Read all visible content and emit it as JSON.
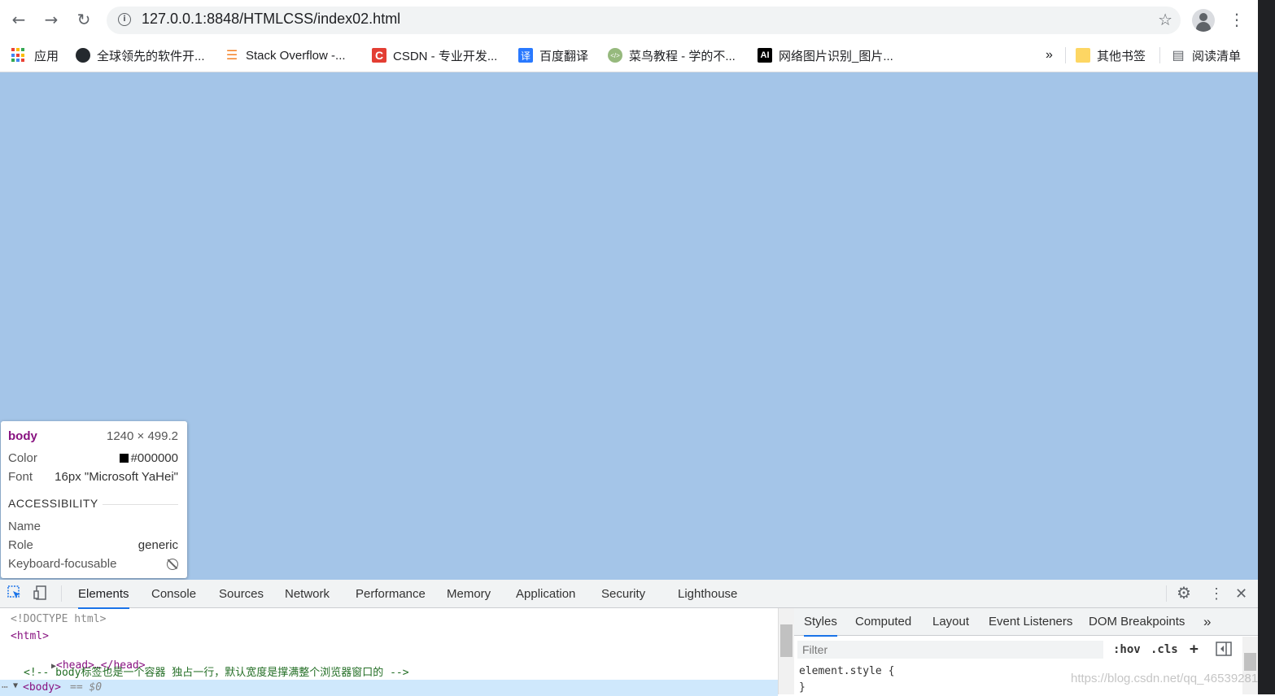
{
  "browser": {
    "url": "127.0.0.1:8848/HTMLCSS/index02.html",
    "back_icon": "arrow-left-icon",
    "forward_icon": "arrow-right-icon",
    "reload_icon": "reload-icon"
  },
  "bookmarks": {
    "apps_label": "应用",
    "items": [
      {
        "label": "全球领先的软件开...",
        "icon": "github-icon"
      },
      {
        "label": "Stack Overflow -...",
        "icon": "stackoverflow-icon"
      },
      {
        "label": "CSDN - 专业开发...",
        "icon": "csdn-icon",
        "icon_text": "C"
      },
      {
        "label": "百度翻译",
        "icon": "baidu-translate-icon",
        "icon_text": "译"
      },
      {
        "label": "菜鸟教程 - 学的不...",
        "icon": "runoob-icon"
      },
      {
        "label": "网络图片识别_图片...",
        "icon": "ai-icon",
        "icon_text": "AI"
      }
    ],
    "overflow_label": "»",
    "other_bookmarks_label": "其他书签",
    "reading_list_label": "阅读清单"
  },
  "viewport": {
    "background": "#a4c5e8"
  },
  "inspector_tooltip": {
    "tag": "body",
    "dimensions": "1240 × 499.2",
    "color_label": "Color",
    "color_value": "#000000",
    "font_label": "Font",
    "font_value": "16px \"Microsoft YaHei\"",
    "accessibility_heading": "ACCESSIBILITY",
    "name_label": "Name",
    "role_label": "Role",
    "role_value": "generic",
    "focusable_label": "Keyboard-focusable"
  },
  "devtools": {
    "tabs": [
      "Elements",
      "Console",
      "Sources",
      "Network",
      "Performance",
      "Memory",
      "Application",
      "Security",
      "Lighthouse"
    ],
    "active_tab": "Elements",
    "dom_lines": {
      "doctype": "<!DOCTYPE html>",
      "html_open": "<html>",
      "head_collapsed": "<head>…</head>",
      "comment": "<!-- body标签也是一个容器 独占一行，默认宽度是撑满整个浏览器窗口的 -->",
      "body_selected": "<body>",
      "body_marker": "== $0"
    },
    "styles_tabs": [
      "Styles",
      "Computed",
      "Layout",
      "Event Listeners",
      "DOM Breakpoints"
    ],
    "styles_overflow": "»",
    "filter_placeholder": "Filter",
    "hov_label": ":hov",
    "cls_label": ".cls",
    "add_label": "+",
    "element_style_open": "element.style {",
    "element_style_close": "}"
  },
  "watermark": "https://blog.csdn.net/qq_46539281"
}
